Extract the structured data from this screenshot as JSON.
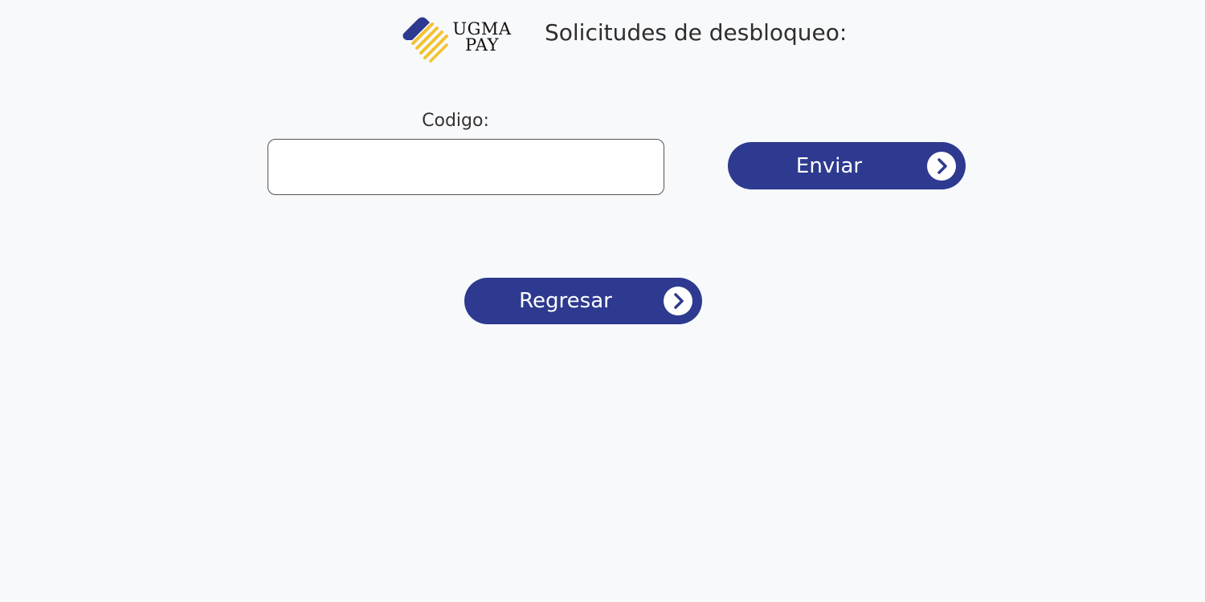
{
  "brand": {
    "logo_line1": "UGMA",
    "logo_line2": "PAY",
    "colors": {
      "navy": "#2d3a8f",
      "gold": "#f2c230"
    }
  },
  "header": {
    "title": "Solicitudes de desbloqueo:"
  },
  "form": {
    "code_label": "Codigo:",
    "code_value": "",
    "send_label": "Enviar",
    "send_icon": "chevron-right-icon"
  },
  "footer": {
    "back_label": "Regresar",
    "back_icon": "chevron-right-icon"
  },
  "theme": {
    "background": "#f8f9fb",
    "button_bg": "#2d3a8f",
    "button_text": "#ffffff"
  }
}
